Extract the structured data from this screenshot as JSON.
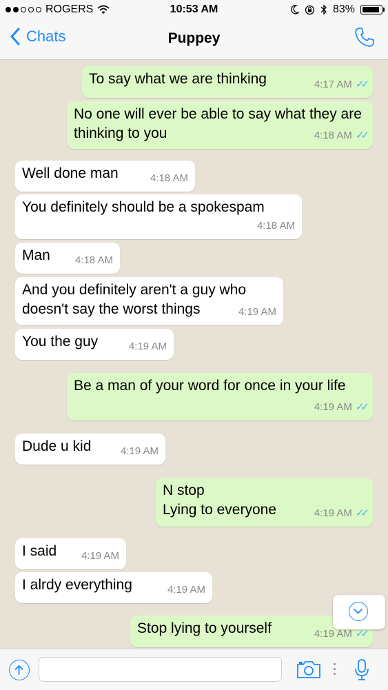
{
  "status_bar": {
    "carrier": "ROGERS",
    "time": "10:53 AM",
    "battery": "83%"
  },
  "header": {
    "back_label": "Chats",
    "title": "Puppey"
  },
  "messages": [
    {
      "direction": "out",
      "text": "To say what we are thinking",
      "time": "4:17 AM"
    },
    {
      "direction": "out",
      "text": "No one will ever be able to say what they are thinking to you",
      "time": "4:18 AM"
    },
    {
      "direction": "in",
      "text": "Well done man",
      "time": "4:18 AM"
    },
    {
      "direction": "in",
      "text": "You definitely should be a spokespam",
      "time": "4:18 AM"
    },
    {
      "direction": "in",
      "text": "Man",
      "time": "4:18 AM"
    },
    {
      "direction": "in",
      "text": "And you definitely aren't a guy who doesn't say the worst things",
      "time": "4:19 AM"
    },
    {
      "direction": "in",
      "text": "You the guy",
      "time": "4:19 AM"
    },
    {
      "direction": "out",
      "text": "Be a man of your word for once in your life",
      "time": "4:19 AM"
    },
    {
      "direction": "in",
      "text": "Dude u kid",
      "time": "4:19 AM"
    },
    {
      "direction": "out",
      "text": "N stop\nLying to everyone",
      "time": "4:19 AM"
    },
    {
      "direction": "in",
      "text": "I said",
      "time": "4:19 AM"
    },
    {
      "direction": "in",
      "text": "I alrdy everything",
      "time": "4:19 AM"
    },
    {
      "direction": "out",
      "text": "Stop lying to yourself",
      "time": "4:19 AM"
    }
  ],
  "input": {
    "placeholder": ""
  },
  "colors": {
    "accent": "#1d8cf8",
    "outgoing_bubble": "#dcf8c6",
    "incoming_bubble": "#ffffff",
    "chat_background": "#e8e2d6",
    "read_ticks": "#4fb6ec"
  },
  "icons": {
    "status": [
      "signal-dots-icon",
      "wifi-icon",
      "moon-icon",
      "rotation-lock-icon",
      "bluetooth-icon",
      "battery-icon"
    ],
    "header": [
      "chevron-left-icon",
      "phone-icon"
    ],
    "input": [
      "upload-icon",
      "camera-icon",
      "more-dots-icon",
      "microphone-icon"
    ],
    "chat": [
      "double-check-icon",
      "scroll-down-icon"
    ]
  }
}
